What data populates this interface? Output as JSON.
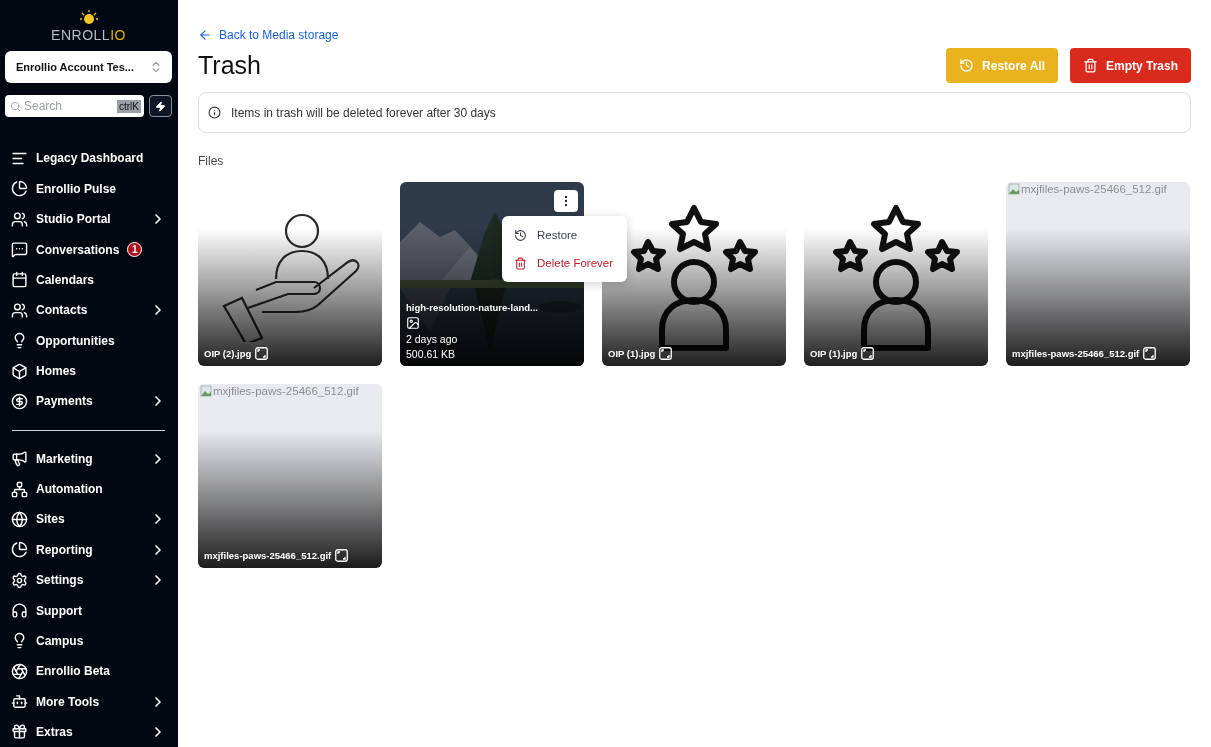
{
  "sidebar": {
    "logo": {
      "text": "ENROLL",
      "accent": "IO"
    },
    "account": {
      "name": "Enrollio Account Tes..."
    },
    "search": {
      "placeholder": "Search",
      "shortcut": "ctrlK"
    },
    "sections": [
      [
        {
          "label": "Legacy Dashboard",
          "arrow": false
        },
        {
          "label": "Enrollio Pulse",
          "arrow": false
        },
        {
          "label": "Studio Portal",
          "arrow": true
        },
        {
          "label": "Conversations",
          "arrow": false,
          "badge": "1"
        },
        {
          "label": "Calendars",
          "arrow": false
        },
        {
          "label": "Contacts",
          "arrow": true
        },
        {
          "label": "Opportunities",
          "arrow": false
        },
        {
          "label": "Homes",
          "arrow": false
        },
        {
          "label": "Payments",
          "arrow": true
        }
      ],
      [
        {
          "label": "Marketing",
          "arrow": true
        },
        {
          "label": "Automation",
          "arrow": false
        },
        {
          "label": "Sites",
          "arrow": true
        },
        {
          "label": "Reporting",
          "arrow": true
        },
        {
          "label": "Settings",
          "arrow": true
        },
        {
          "label": "Support",
          "arrow": false
        },
        {
          "label": "Campus",
          "arrow": false
        },
        {
          "label": "Enrollio Beta",
          "arrow": false
        },
        {
          "label": "More Tools",
          "arrow": true
        },
        {
          "label": "Extras",
          "arrow": true
        }
      ]
    ]
  },
  "header": {
    "back_link": "Back to Media storage",
    "title": "Trash",
    "buttons": [
      {
        "kind": "restore",
        "label": "Restore All"
      },
      {
        "kind": "empty",
        "label": "Empty Trash"
      }
    ]
  },
  "notice": "Items in trash will be deleted forever after 30 days",
  "files_heading": "Files",
  "files": [
    {
      "kind": "hand",
      "name": "OIP (2).jpg"
    },
    {
      "name": "high-resolution-nature-land...",
      "age": "2 days ago",
      "size": "500.61 KB",
      "menu": [
        {
          "kind": "restore",
          "label": "Restore"
        },
        {
          "kind": "delete",
          "label": "Delete Forever"
        }
      ]
    },
    {
      "kind": "stars",
      "name": "OIP (1).jpg"
    },
    {
      "kind": "stars",
      "name": "OIP (1).jpg"
    },
    {
      "kind": "broken",
      "alt": "mxjfiles-paws-25466_512.gif",
      "name": "mxjfiles-paws-25466_512.gif"
    },
    {
      "kind": "broken",
      "alt": "mxjfiles-paws-25466_512.gif",
      "name": "mxjfiles-paws-25466_512.gif"
    }
  ]
}
